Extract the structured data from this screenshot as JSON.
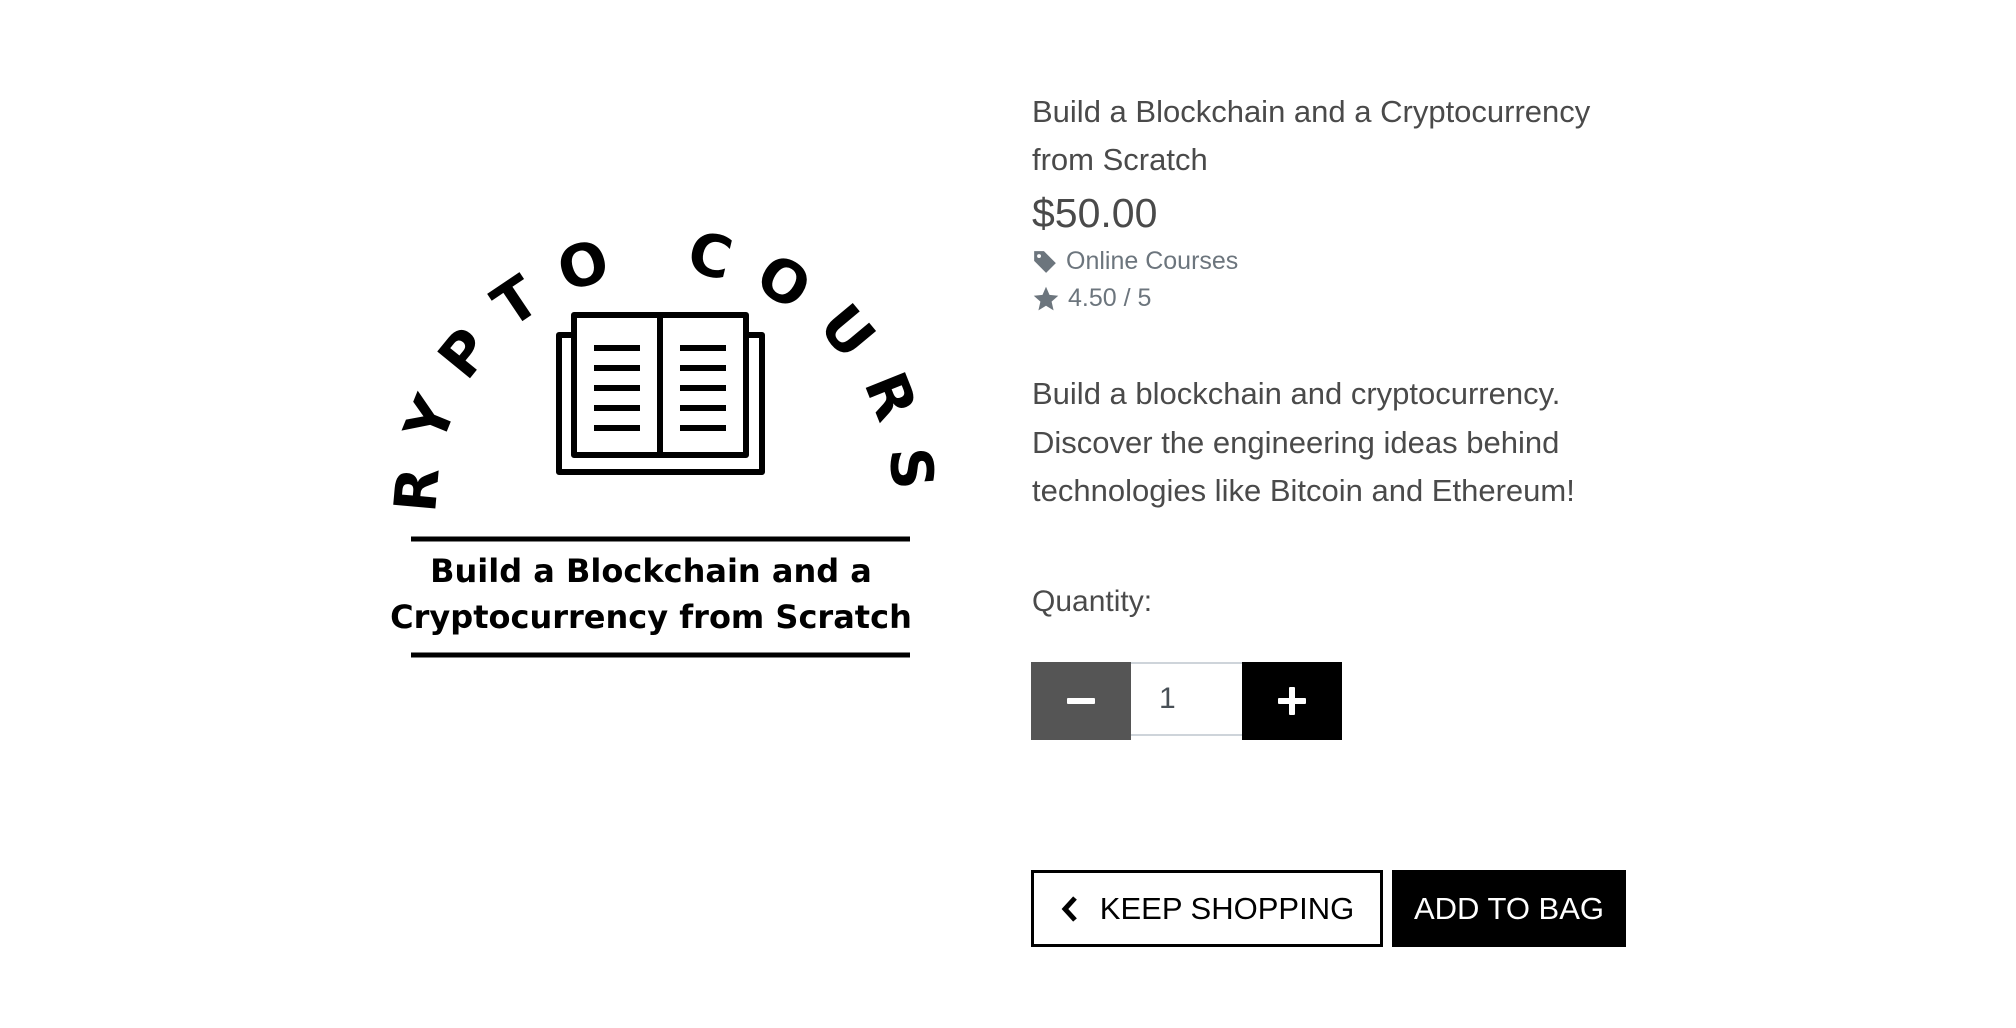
{
  "product": {
    "title": "Build a Blockchain and a Cryptocurrency from Scratch",
    "price": "$50.00",
    "category": "Online Courses",
    "rating": "4.50 / 5",
    "description": "Build a blockchain and cryptocurrency. Discover the engineering ideas behind technologies like Bitcoin and Ethereum!"
  },
  "logo": {
    "arc_text": "CRYPTO COURSE",
    "line1": "Build a Blockchain and a",
    "line2": "Cryptocurrency from Scratch"
  },
  "quantity": {
    "label": "Quantity:",
    "value": "1"
  },
  "buttons": {
    "keep_shopping": "KEEP SHOPPING",
    "add_to_bag": "ADD TO BAG"
  },
  "icons": {
    "category": "tag-icon",
    "rating": "star-icon",
    "decrement": "minus-icon",
    "increment": "plus-icon",
    "back": "chevron-left-icon"
  },
  "colors": {
    "text": "#4a4a4a",
    "muted": "#6c757d",
    "decrement_bg": "#555555",
    "primary_bg": "#000000"
  }
}
